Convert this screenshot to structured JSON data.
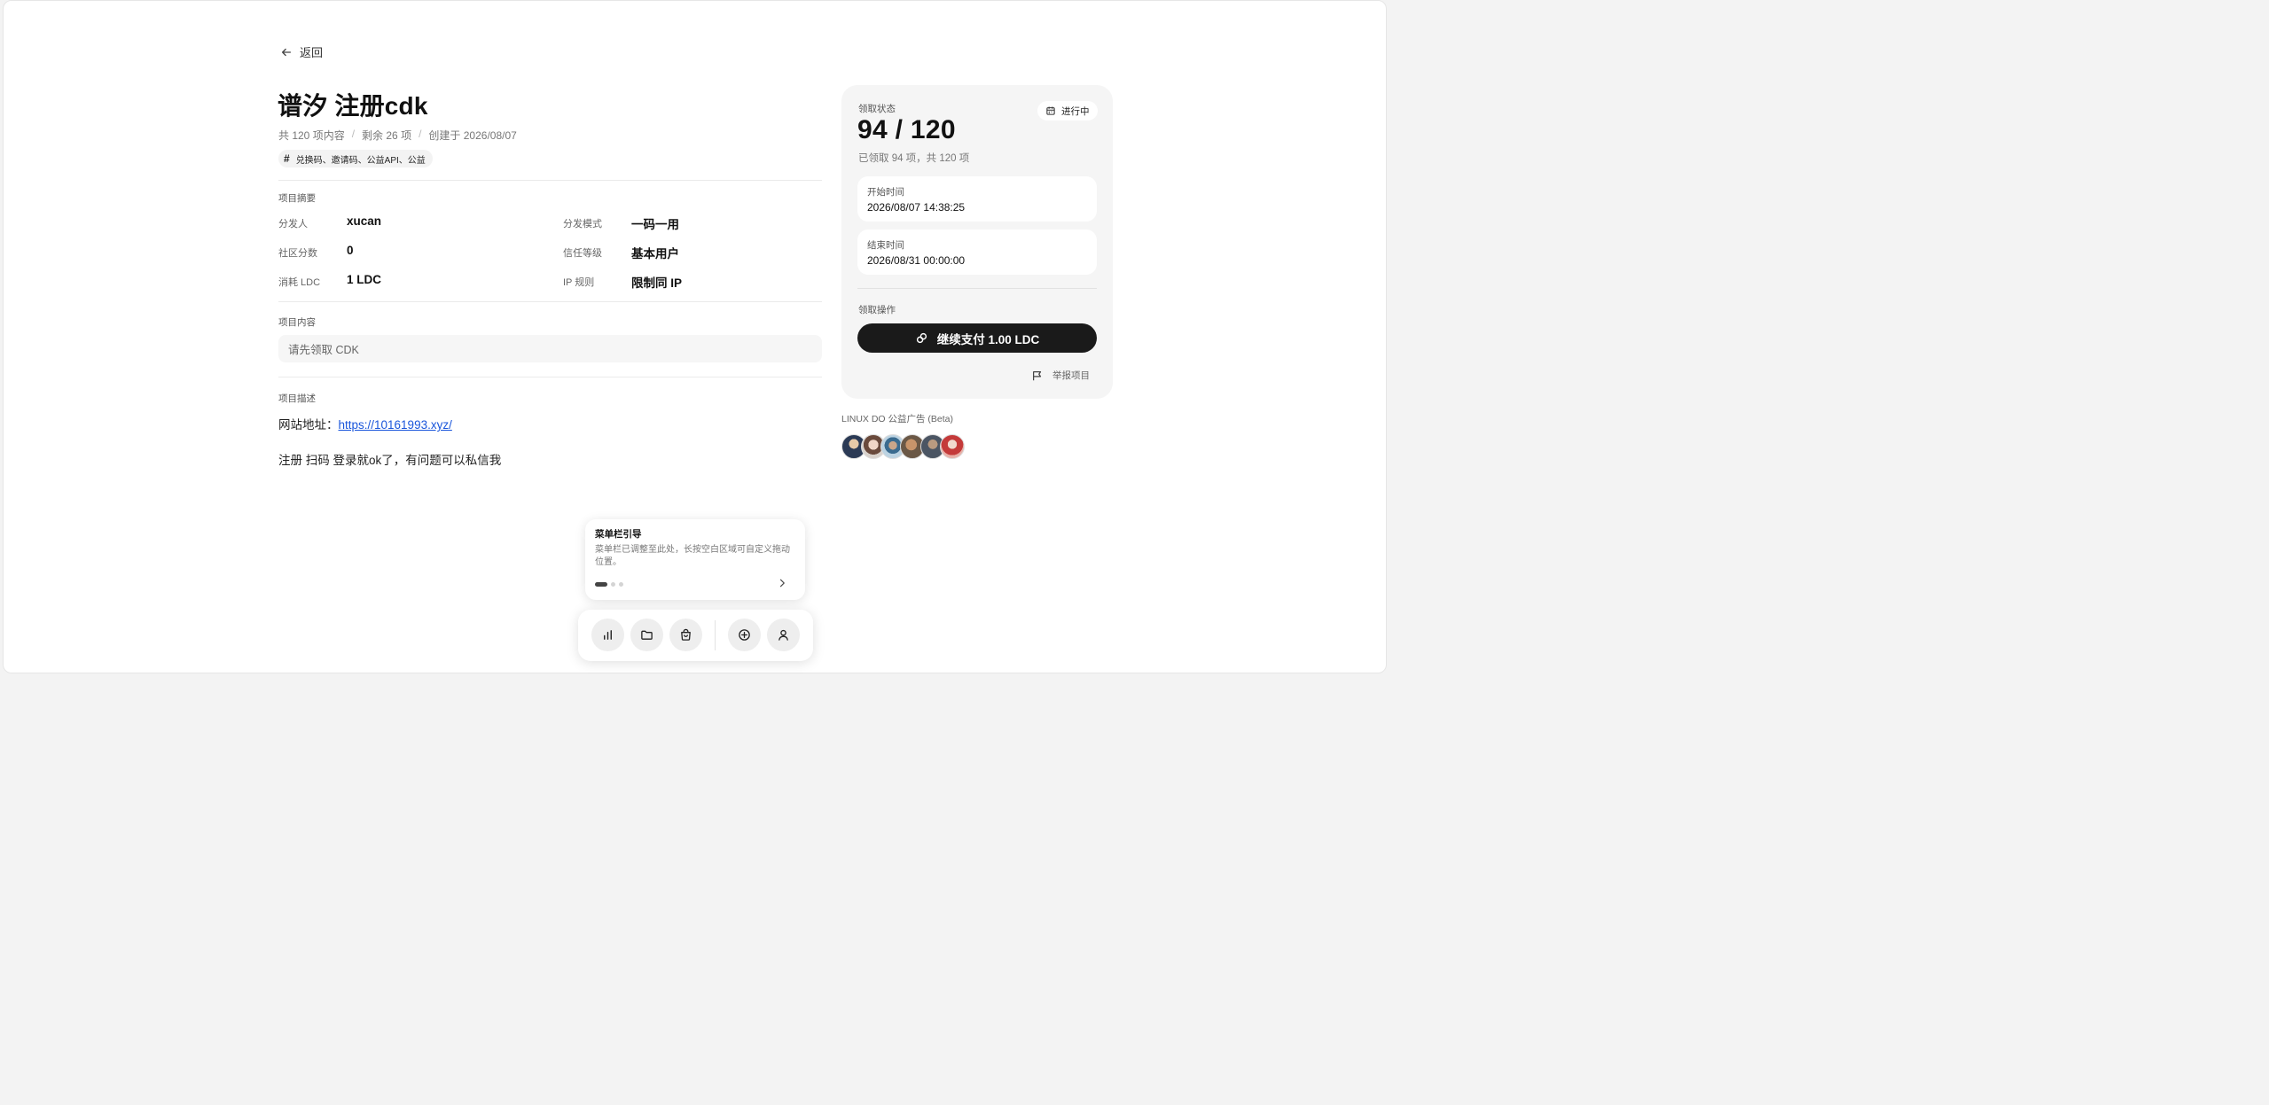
{
  "back": {
    "label": "返回"
  },
  "project": {
    "title": "谱汐 注册cdk",
    "meta": {
      "total": "共 120 项内容",
      "remaining": "剩余 26 项",
      "created": "创建于 2026/08/07"
    },
    "tags": "兑换码、邀请码、公益API、公益"
  },
  "summary": {
    "label": "项目摘要",
    "rows": [
      {
        "label": "分发人",
        "value": "xucan"
      },
      {
        "label": "分发模式",
        "value": "一码一用"
      },
      {
        "label": "社区分数",
        "value": "0"
      },
      {
        "label": "信任等级",
        "value": "基本用户"
      },
      {
        "label": "消耗 LDC",
        "value": "1 LDC"
      },
      {
        "label": "IP 规则",
        "value": "限制同 IP"
      }
    ]
  },
  "content": {
    "label": "项目内容",
    "placeholder": "请先领取 CDK"
  },
  "description": {
    "label": "项目描述",
    "site_prefix": "网站地址：",
    "site_link": "https://10161993.xyz/",
    "text": "注册 扫码 登录就ok了，有问题可以私信我"
  },
  "claim": {
    "status_label": "领取状态",
    "status_chip": "进行中",
    "count": "94 / 120",
    "count_detail": "已领取 94 项，共 120 项",
    "claimed_fraction": 0.7833,
    "start_label": "开始时间",
    "start_value": "2026/08/07 14:38:25",
    "end_label": "结束时间",
    "end_value": "2026/08/31 00:00:00",
    "action_label": "领取操作",
    "pay_button": "继续支付 1.00 LDC",
    "report": "举报项目"
  },
  "ads": {
    "label": "LINUX DO 公益广告 (Beta)"
  },
  "guide": {
    "title": "菜单栏引导",
    "body": "菜单栏已调整至此处，长按空白区域可自定义拖动位置。",
    "page": 1,
    "pages": 3
  },
  "dock": {
    "icons": [
      "chart-icon",
      "folder-icon",
      "shopping-bag-icon",
      "plus-circle-icon",
      "user-icon"
    ]
  },
  "colors": {
    "link": "#1a56db",
    "primary_button": "#1a1a1a",
    "card_bg": "#f5f5f5"
  }
}
